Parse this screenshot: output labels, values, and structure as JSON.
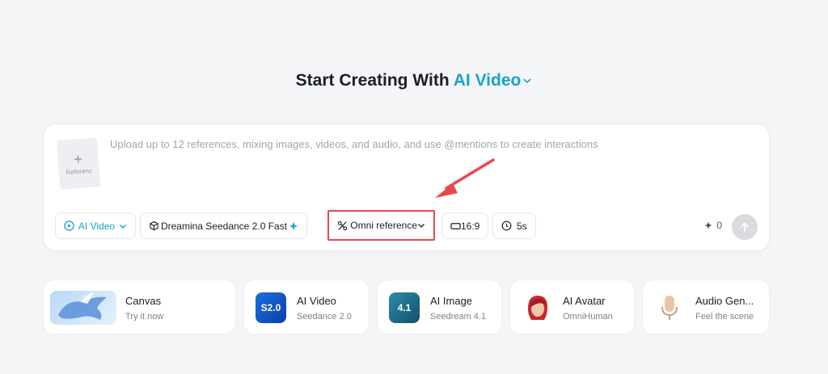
{
  "headline": {
    "prefix": "Start Creating With",
    "accent": "AI Video"
  },
  "composer": {
    "reference_label": "Referenc",
    "placeholder": "Upload up to 12 references, mixing images, videos, and audio, and use @mentions to create interactions",
    "toolbar": {
      "mode_label": "AI Video",
      "model_label": "Dreamina Seedance 2.0 Fast",
      "reference_mode_label": "Omni reference",
      "aspect_ratio": "16:9",
      "duration": "5s"
    },
    "credits": "0"
  },
  "cards": [
    {
      "title": "Canvas",
      "subtitle": "Try it now"
    },
    {
      "title": "AI Video",
      "subtitle": "Seedance 2.0",
      "badge": "S2.0"
    },
    {
      "title": "AI Image",
      "subtitle": "Seedream 4.1",
      "badge": "4.1"
    },
    {
      "title": "AI Avatar",
      "subtitle": "OmniHuman"
    },
    {
      "title": "Audio Gen...",
      "subtitle": "Feel the scene"
    }
  ],
  "colors": {
    "accent": "#1aa3c8",
    "highlight": "#e8484d",
    "background": "#f4f5f7"
  }
}
